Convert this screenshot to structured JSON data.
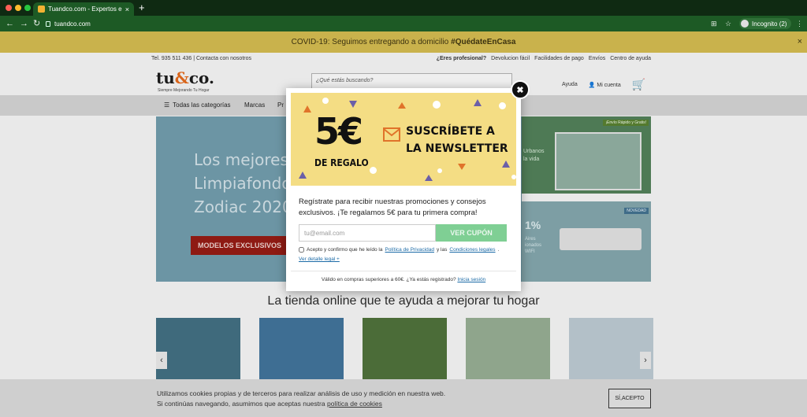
{
  "browser": {
    "tab_title": "Tuandco.com - Expertos en m",
    "tab_close": "×",
    "new_tab": "+",
    "url": "tuandco.com",
    "profile_label": "Incognito (2)"
  },
  "page": {
    "covid_text": "COVID-19: Seguimos entregando a domicilio",
    "covid_hashtag": "#QuédateEnCasa",
    "covid_close": "×",
    "contact": "Tel. 935 511 436 | Contacta con nosotros",
    "top_links": [
      "¿Eres profesional?",
      "Devolucion fácil",
      "Facilidades de pago",
      "Envíos",
      "Centro de ayuda"
    ],
    "logo_text": "tu",
    "logo_amp": "&",
    "logo_end": "co.",
    "logo_tagline": "Siempre Mejorando Tu Hogar",
    "search_placeholder": "¿Qué estás buscando?",
    "help": "Ayuda",
    "account": "Mi cuenta",
    "nav": {
      "all_categories": "Todas las categorías",
      "brands": "Marcas",
      "more": "Pr"
    },
    "hero": {
      "line1": "Los mejores",
      "line2": "Limpiafondo",
      "line3": "Zodiac 2020",
      "cta": "MODELOS EXCLUSIVOS"
    },
    "side1": {
      "badge": "¡Envío Rápido y Gratis!",
      "text_line1": "Urbanos",
      "text_line2": "la vida"
    },
    "side2": {
      "badge": "NOVEDAD",
      "pct": "1%",
      "text_line1": "Aires",
      "text_line2": "ionados",
      "text_line3": "WIFI"
    },
    "tagline": "La tienda online que te ayuda a mejorar tu hogar",
    "arrow_left": "‹",
    "arrow_right": "›"
  },
  "cookie": {
    "line1": "Utilizamos cookies propias y de terceros para realizar análisis de uso y medición en nuestra web.",
    "line2": "Si continúas navegando, asumimos que aceptas nuestra",
    "policy_link": "política de cookies",
    "accept": "SÍ,ACEPTO"
  },
  "modal": {
    "close": "✖",
    "amount": "5€",
    "gift": "DE REGALO",
    "subscribe_line1": "SUSCRÍBETE A",
    "subscribe_line2": "LA NEWSLETTER",
    "description": "Regístrate para recibir nuestras promociones y consejos exclusivos. ¡Te regalamos 5€ para tu primera compra!",
    "email_placeholder": "tu@email.com",
    "submit": "VER CUPÓN",
    "consent_prefix": "Acepto y confirmo que he leído la",
    "privacy_link": "Política de Privacidad",
    "consent_mid": "y las",
    "conditions_link": "Condiciones legales",
    "consent_end": ".",
    "legal_link": "Ver detalle legal +",
    "footer_text": "Válido en compras superiores a 60€. ¿Ya estás registrado?",
    "login_link": "Inicia sesión"
  },
  "colors": {
    "chrome_dark": "#0f2a12",
    "chrome_green": "#1d5a25",
    "banner_yellow": "#f4dd84",
    "submit_green": "#7fcf94",
    "link_blue": "#1c6ba7"
  }
}
